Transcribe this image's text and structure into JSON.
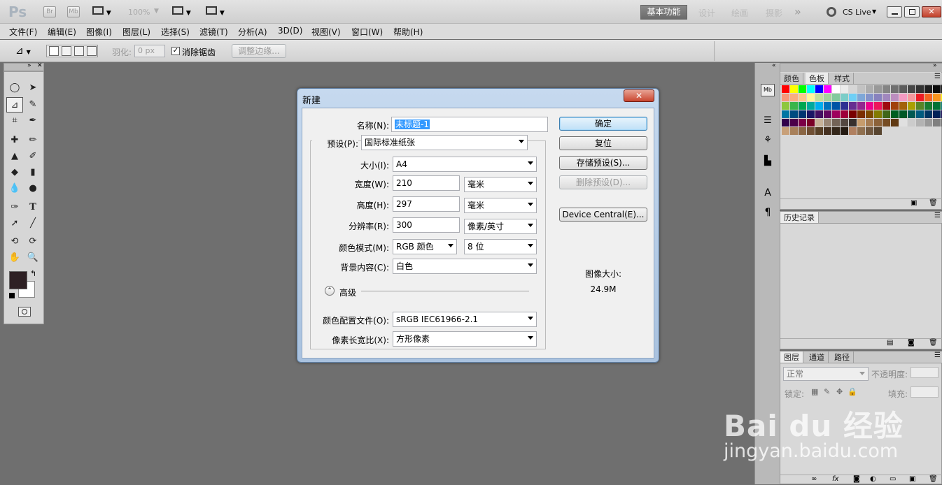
{
  "app": {
    "logo": "Ps",
    "bridge_label": "Br",
    "minibridge_label": "Mb",
    "zoom": "100%",
    "workspaces": [
      "基本功能",
      "设计",
      "绘画",
      "摄影"
    ],
    "more_workspaces": "»",
    "cslive": "CS Live"
  },
  "menu": [
    "文件(F)",
    "编辑(E)",
    "图像(I)",
    "图层(L)",
    "选择(S)",
    "滤镜(T)",
    "分析(A)",
    "3D(D)",
    "视图(V)",
    "窗口(W)",
    "帮助(H)"
  ],
  "options": {
    "feather_label": "羽化:",
    "feather_value": "0 px",
    "antialias_label": "消除锯齿",
    "refine_edge": "调整边缘..."
  },
  "swatch_panel": {
    "tabs": [
      "颜色",
      "色板",
      "样式"
    ],
    "selected_tab": "色板"
  },
  "history_panel": {
    "title": "历史记录"
  },
  "layers_panel": {
    "tabs": [
      "图层",
      "通道",
      "路径"
    ],
    "blend_mode": "正常",
    "opacity_label": "不透明度:",
    "lock_label": "锁定:",
    "fill_label": "填充:"
  },
  "dialog": {
    "title": "新建",
    "name_label": "名称(N):",
    "name_value": "未标题-1",
    "preset_label": "预设(P):",
    "preset_value": "国际标准纸张",
    "size_label": "大小(I):",
    "size_value": "A4",
    "width_label": "宽度(W):",
    "width_value": "210",
    "width_unit": "毫米",
    "height_label": "高度(H):",
    "height_value": "297",
    "height_unit": "毫米",
    "resolution_label": "分辨率(R):",
    "resolution_value": "300",
    "resolution_unit": "像素/英寸",
    "colormode_label": "颜色模式(M):",
    "colormode_value": "RGB 颜色",
    "bitdepth_value": "8 位",
    "background_label": "背景内容(C):",
    "background_value": "白色",
    "advanced_label": "高级",
    "profile_label": "颜色配置文件(O):",
    "profile_value": "sRGB IEC61966-2.1",
    "aspect_label": "像素长宽比(X):",
    "aspect_value": "方形像素",
    "ok": "确定",
    "reset": "复位",
    "save_preset": "存储预设(S)...",
    "delete_preset": "删除预设(D)...",
    "device_central": "Device Central(E)...",
    "image_size_label": "图像大小:",
    "image_size_value": "24.9M"
  },
  "watermark": {
    "brand": "Bai du 经验",
    "url": "jingyan.baidu.com"
  },
  "colors": {
    "workspace_bg": "#6f6f6f",
    "selection": "#3399ff",
    "dialog_frame": "#b8cfe9"
  }
}
